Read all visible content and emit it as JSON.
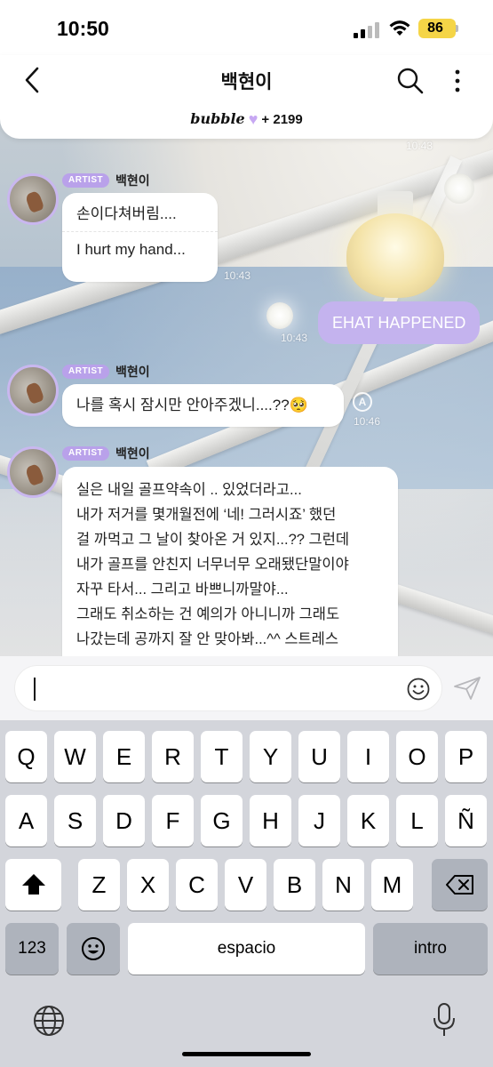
{
  "status": {
    "time": "10:50",
    "battery": "86"
  },
  "header": {
    "title": "백현이",
    "bubble_logo": "bubble",
    "bubble_count": "+ 2199"
  },
  "messages": {
    "m1": {
      "badge": "ARTIST",
      "sender": "백현이",
      "text_ko": "손이다쳐버림....",
      "text_en": "I hurt my hand...",
      "time": "10:43"
    },
    "top_time": "10:43",
    "out": {
      "text": "EHAT HAPPENED",
      "time": "10:43"
    },
    "m2": {
      "badge": "ARTIST",
      "sender": "백현이",
      "text": "나를 혹시 잠시만 안아주겠니....??🥺",
      "translate": "A",
      "time": "10:46"
    },
    "m3": {
      "badge": "ARTIST",
      "sender": "백현이",
      "lines": [
        "실은 내일 골프약속이 .. 있었더라고...",
        "내가 저거를 몇개월전에 ‘네! 그러시죠’ 했던",
        "걸 까먹고 그 날이 찾아온 거 있지...?? 그런데",
        "내가 골프를 안친지 너무너무 오래됐단말이야",
        "자꾸 타서... 그리고 바쁘니까말야...",
        "그래도 취소하는 건 예의가 아니니까 그래도",
        "나갔는데 공까지 잘 안 맞아봐...^^ 스트레스"
      ]
    }
  },
  "input": {
    "placeholder": ""
  },
  "keyboard": {
    "row1": [
      "Q",
      "W",
      "E",
      "R",
      "T",
      "Y",
      "U",
      "I",
      "O",
      "P"
    ],
    "row2": [
      "A",
      "S",
      "D",
      "F",
      "G",
      "H",
      "J",
      "K",
      "L",
      "Ñ"
    ],
    "row3": [
      "Z",
      "X",
      "C",
      "V",
      "B",
      "N",
      "M"
    ],
    "numbers_label": "123",
    "space_label": "espacio",
    "return_label": "intro"
  },
  "colors": {
    "accent": "#c4b3ee",
    "badge": "#b9a1ea",
    "battery": "#f5d547"
  }
}
